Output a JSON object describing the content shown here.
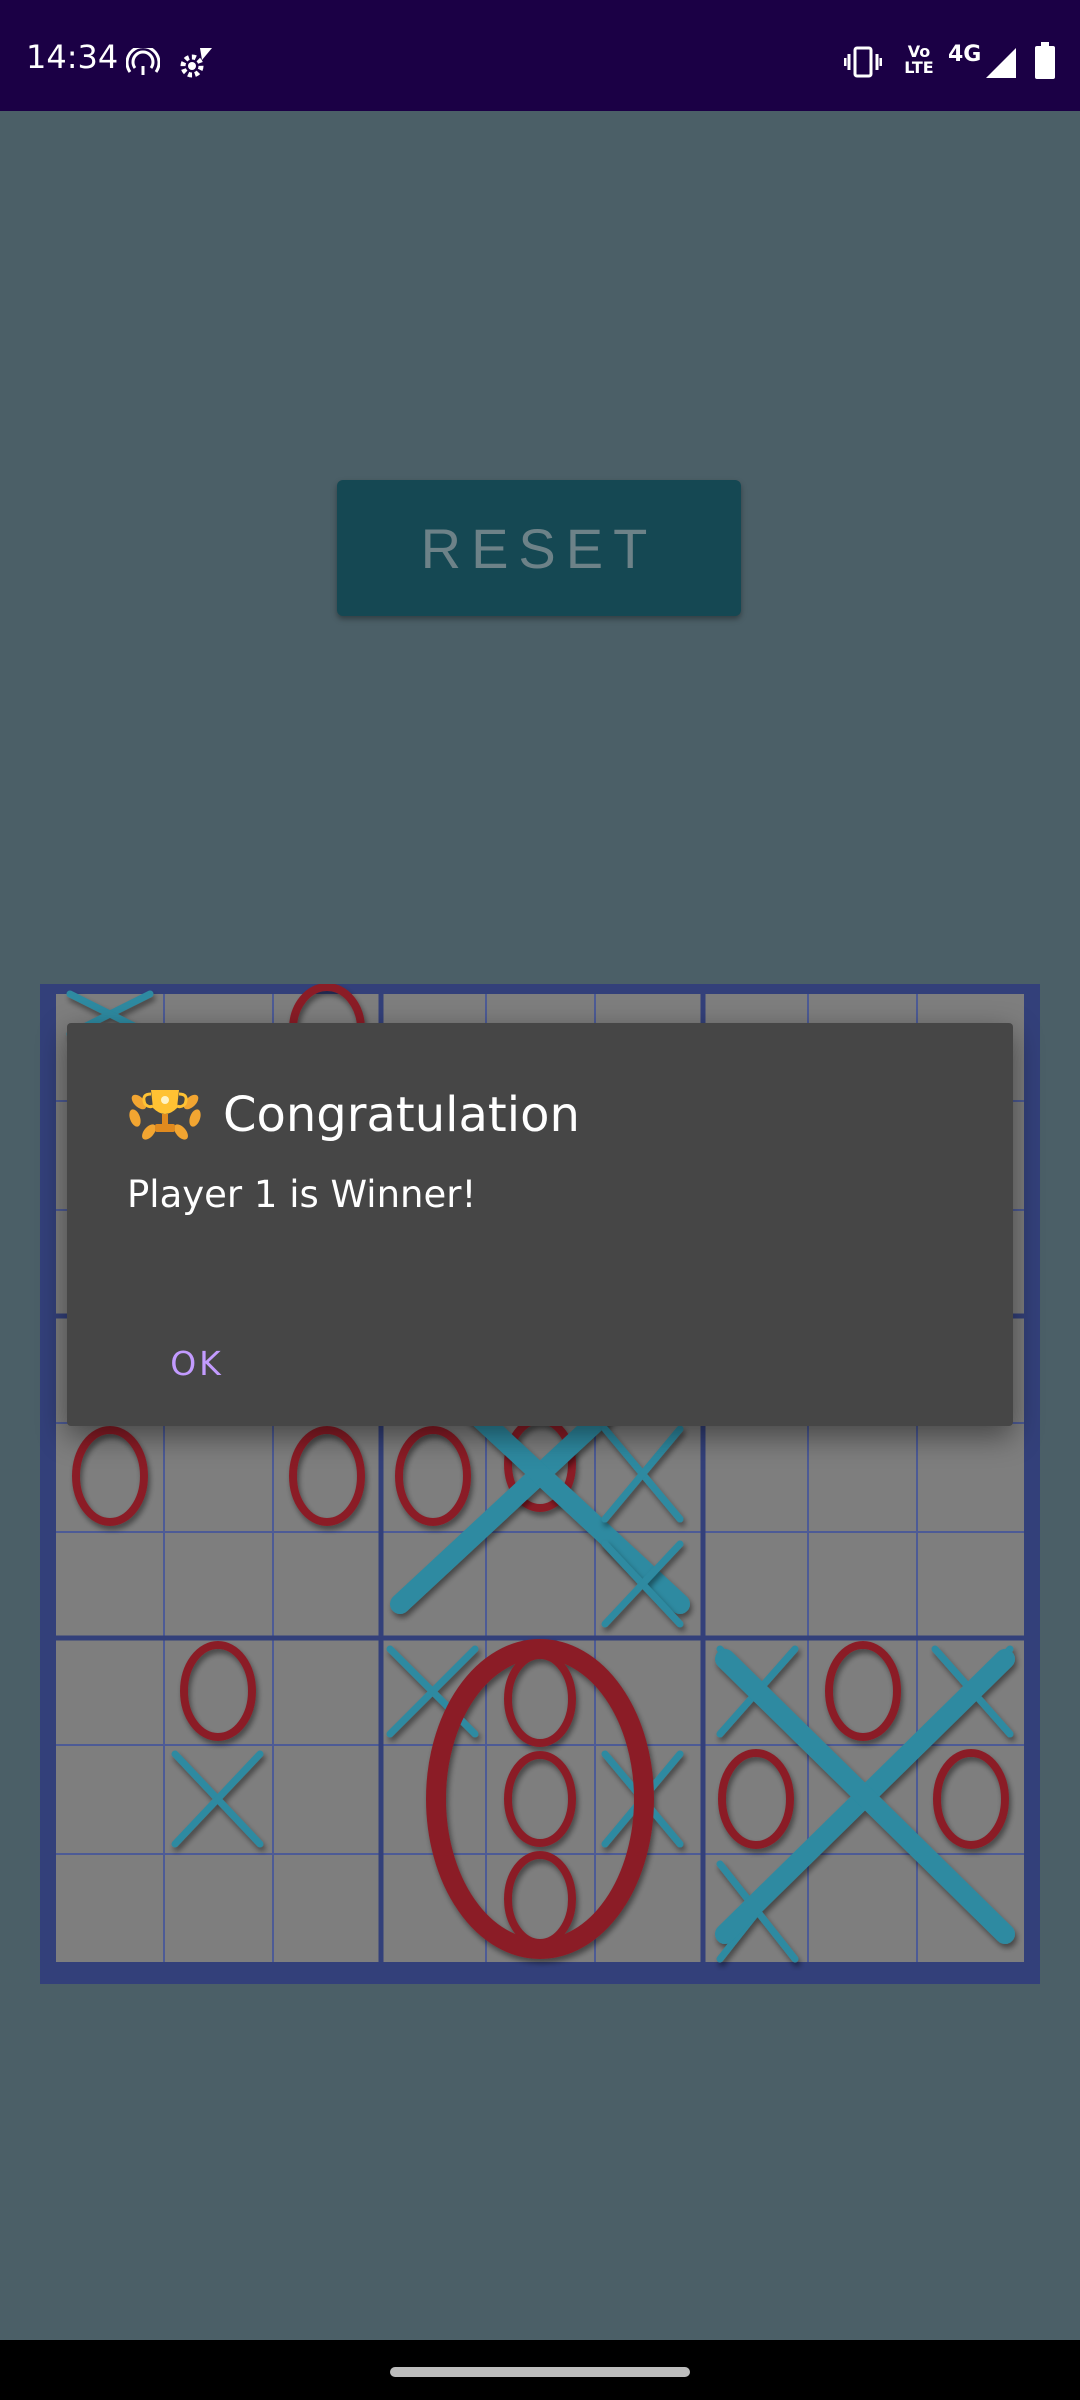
{
  "status_bar": {
    "time": "14:34",
    "network": "4G",
    "volte_top": "Vo",
    "volte_bottom": "LTE",
    "icons": [
      "hotspot-icon",
      "settings-icon",
      "vibrate-icon",
      "volte-icon",
      "signal-icon",
      "battery-icon"
    ]
  },
  "reset_button": {
    "label": "RESET"
  },
  "board": {
    "description_marks": [
      "X",
      "O"
    ],
    "colors": {
      "frame": "#33407a",
      "cell": "#7e7e7e",
      "x": "#2d8aa1",
      "o": "#8b1f27"
    }
  },
  "dialog": {
    "title": "Congratulation",
    "message": "Player 1 is Winner!",
    "ok_label": "OK",
    "icon": "trophy-laurel-icon"
  },
  "colors": {
    "background": "#4b5f67",
    "status_bar": "#1b0045",
    "dialog": "#464646",
    "accent": "#c39bff"
  }
}
